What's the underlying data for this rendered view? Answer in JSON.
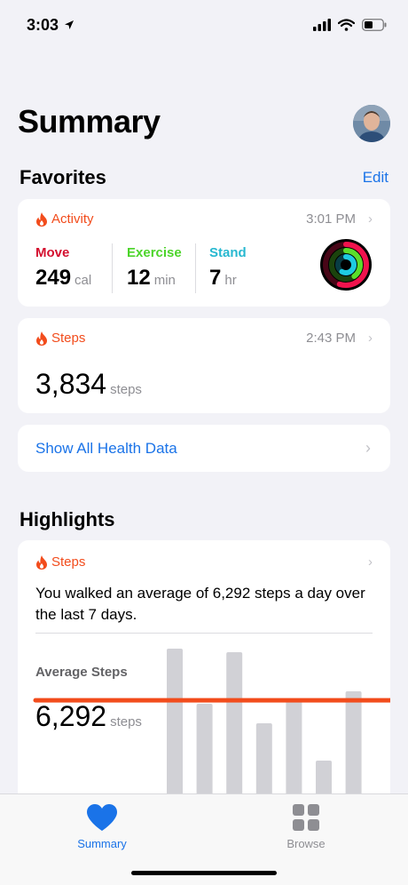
{
  "status_bar": {
    "time": "3:03"
  },
  "header": {
    "title": "Summary"
  },
  "favorites": {
    "title": "Favorites",
    "edit_label": "Edit",
    "activity": {
      "category": "Activity",
      "time": "3:01 PM",
      "move": {
        "label": "Move",
        "value": "249",
        "unit": "cal",
        "progress": 0.55
      },
      "exercise": {
        "label": "Exercise",
        "value": "12",
        "unit": "min",
        "progress": 0.4
      },
      "stand": {
        "label": "Stand",
        "value": "7",
        "unit": "hr",
        "progress": 0.58
      },
      "colors": {
        "move": "#f0134d",
        "exercise": "#5bde2b",
        "stand": "#1ecbe1"
      }
    },
    "steps": {
      "category": "Steps",
      "time": "2:43 PM",
      "value": "3,834",
      "unit": "steps"
    },
    "show_all": "Show All Health Data"
  },
  "highlights": {
    "title": "Highlights",
    "card": {
      "category": "Steps",
      "text": "You walked an average of 6,292 steps a day over the last 7 days.",
      "average_label": "Average Steps",
      "average_value": "6,292",
      "average_unit": "steps"
    }
  },
  "tab_bar": {
    "items": [
      {
        "label": "Summary",
        "icon": "heart-icon",
        "active": true
      },
      {
        "label": "Browse",
        "icon": "grid-icon",
        "active": false
      }
    ]
  },
  "chart_data": {
    "type": "bar",
    "values": [
      9900,
      6800,
      9700,
      5700,
      7000,
      3600,
      7500
    ],
    "average": 6292,
    "ylim": [
      0,
      10000
    ]
  },
  "colors": {
    "accent": "#1a73e8",
    "category": "#f24c1c",
    "average_line": "#f24c1c",
    "bar": "#d1d1d6"
  }
}
